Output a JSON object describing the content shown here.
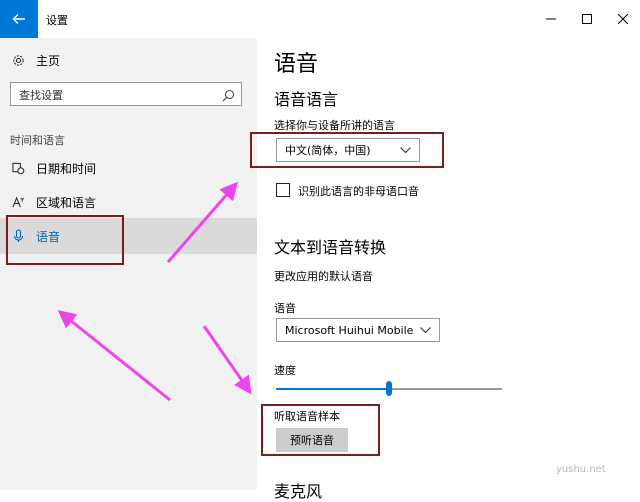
{
  "window": {
    "title": "设置",
    "accent_color": "#0078d7",
    "controls": [
      "minimize-icon",
      "maximize-icon",
      "close-icon"
    ]
  },
  "sidebar": {
    "home_label": "主页",
    "search_placeholder": "查找设置",
    "section_header": "时间和语言",
    "items": [
      {
        "label": "日期和时间",
        "icon": "calendar-clock-icon",
        "selected": false
      },
      {
        "label": "区域和语言",
        "icon": "language-icon",
        "selected": false
      },
      {
        "label": "语音",
        "icon": "microphone-icon",
        "selected": true
      }
    ],
    "selected_bg": "#dadada",
    "bg": "#f2f2f2"
  },
  "main": {
    "page_title": "语音",
    "speech_language": {
      "heading": "语音语言",
      "choose_label": "选择你与设备所讲的语言",
      "selected_language": "中文(简体，中国)",
      "accent_checkbox_label": "识别此语言的非母语口音",
      "accent_checked": false
    },
    "tts": {
      "heading": "文本到语音转换",
      "default_voice_label": "更改应用的默认语音",
      "voice_label": "语音",
      "selected_voice": "Microsoft Huihui Mobile",
      "speed_label": "速度",
      "speed_value": 0.5,
      "sample_label": "听取语音样本",
      "preview_button": "预听语音"
    },
    "next_section_partial": "麦克风"
  },
  "watermark": "yushu.net",
  "annotation_colors": {
    "box": "#7a1c1c",
    "arrow": "#ee44ee"
  }
}
